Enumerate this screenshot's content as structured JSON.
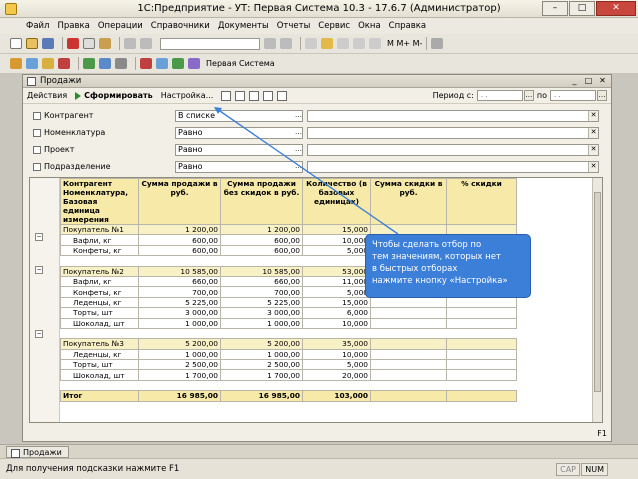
{
  "window": {
    "title": "1С:Предприятие - УТ: Первая Система 10.3 - 17.6.7 (Администратор)"
  },
  "menu": [
    "Файл",
    "Правка",
    "Операции",
    "Справочники",
    "Документы",
    "Отчеты",
    "Сервис",
    "Окна",
    "Справка"
  ],
  "toolbar2": {
    "label": "Первая Система"
  },
  "form": {
    "title": "Продажи",
    "actions": "Действия",
    "run": "Сформировать",
    "settings": "Настройка...",
    "period_from_label": "Период с:",
    "period_from_value": ". .",
    "period_to_label": "по",
    "period_to_value": ". ."
  },
  "filters": [
    {
      "label": "Контрагент",
      "condition": "В списке"
    },
    {
      "label": "Номенклатура",
      "condition": "Равно"
    },
    {
      "label": "Проект",
      "condition": "Равно"
    },
    {
      "label": "Подразделение",
      "condition": "Равно"
    }
  ],
  "report": {
    "headers": [
      "Контрагент Номенклатура, Базовая единица измерения",
      "Сумма продажи в руб.",
      "Сумма продажи без скидок в руб.",
      "Количество (в базовых единицах)",
      "Сумма скидки в руб.",
      "% скидки"
    ],
    "rows": [
      {
        "type": "group",
        "name": "Покупатель №1",
        "sum": "1 200,00",
        "sum_nd": "1 200,00",
        "qty": "15,000"
      },
      {
        "type": "detail",
        "name": "Вафли, кг",
        "sum": "600,00",
        "sum_nd": "600,00",
        "qty": "10,000"
      },
      {
        "type": "detail",
        "name": "Конфеты, кг",
        "sum": "600,00",
        "sum_nd": "600,00",
        "qty": "5,000"
      },
      {
        "type": "group",
        "name": "Покупатель №2",
        "sum": "10 585,00",
        "sum_nd": "10 585,00",
        "qty": "53,000"
      },
      {
        "type": "detail",
        "name": "Вафли, кг",
        "sum": "660,00",
        "sum_nd": "660,00",
        "qty": "11,000"
      },
      {
        "type": "detail",
        "name": "Конфеты, кг",
        "sum": "700,00",
        "sum_nd": "700,00",
        "qty": "5,000"
      },
      {
        "type": "detail",
        "name": "Леденцы, кг",
        "sum": "5 225,00",
        "sum_nd": "5 225,00",
        "qty": "15,000"
      },
      {
        "type": "detail",
        "name": "Торты, шт",
        "sum": "3 000,00",
        "sum_nd": "3 000,00",
        "qty": "6,000"
      },
      {
        "type": "detail",
        "name": "Шоколад, шт",
        "sum": "1 000,00",
        "sum_nd": "1 000,00",
        "qty": "10,000"
      },
      {
        "type": "group",
        "name": "Покупатель №3",
        "sum": "5 200,00",
        "sum_nd": "5 200,00",
        "qty": "35,000"
      },
      {
        "type": "detail",
        "name": "Леденцы, кг",
        "sum": "1 000,00",
        "sum_nd": "1 000,00",
        "qty": "10,000"
      },
      {
        "type": "detail",
        "name": "Торты, шт",
        "sum": "2 500,00",
        "sum_nd": "2 500,00",
        "qty": "5,000"
      },
      {
        "type": "detail",
        "name": "Шоколад, шт",
        "sum": "1 700,00",
        "sum_nd": "1 700,00",
        "qty": "20,000"
      },
      {
        "type": "total",
        "name": "Итог",
        "sum": "16 985,00",
        "sum_nd": "16 985,00",
        "qty": "103,000"
      }
    ]
  },
  "tooltip": {
    "lines": [
      "Чтобы сделать отбор по",
      "тем значениям, которых нет",
      "в быстрых отборах",
      "нажмите кнопку «Настройка»"
    ]
  },
  "f1": "F1",
  "taskbar": {
    "item": "Продажи"
  },
  "status": {
    "hint": "Для получения подсказки нажмите F1",
    "cap": "CAP",
    "num": "NUM"
  },
  "colors": {
    "tooltip_bg": "#3c7fd8",
    "header_bg": "#f7e9a8",
    "group_bg": "#f9f1c6"
  }
}
